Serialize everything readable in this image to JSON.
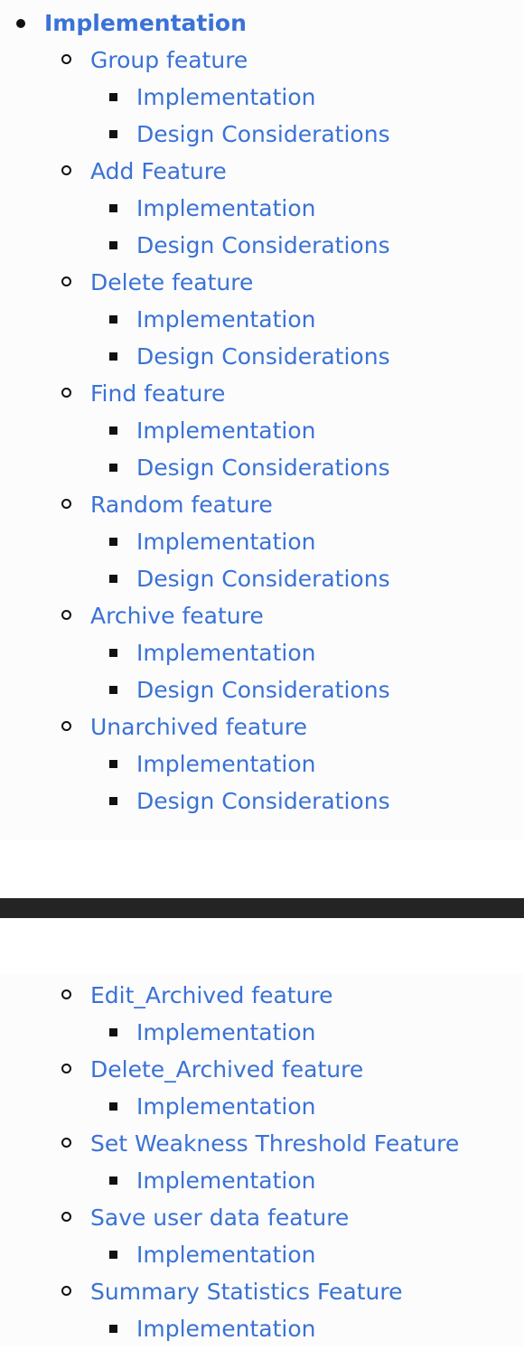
{
  "top": {
    "section_label": "Implementation",
    "features": [
      {
        "label": "Group feature",
        "children": [
          "Implementation",
          "Design Considerations"
        ]
      },
      {
        "label": "Add Feature",
        "children": [
          "Implementation",
          "Design Considerations"
        ]
      },
      {
        "label": "Delete feature",
        "children": [
          "Implementation",
          "Design Considerations"
        ]
      },
      {
        "label": "Find feature",
        "children": [
          "Implementation",
          "Design Considerations"
        ]
      },
      {
        "label": "Random feature",
        "children": [
          "Implementation",
          "Design Considerations"
        ]
      },
      {
        "label": "Archive feature",
        "children": [
          "Implementation",
          "Design Considerations"
        ]
      },
      {
        "label": "Unarchived feature",
        "children": [
          "Implementation",
          "Design Considerations"
        ]
      }
    ]
  },
  "bottom": {
    "features": [
      {
        "label": "Edit_Archived feature",
        "children": [
          "Implementation"
        ]
      },
      {
        "label": "Delete_Archived feature",
        "children": [
          "Implementation"
        ]
      },
      {
        "label": "Set Weakness Threshold Feature",
        "children": [
          "Implementation"
        ]
      },
      {
        "label": "Save user data feature",
        "children": [
          "Implementation"
        ]
      },
      {
        "label": "Summary Statistics Feature",
        "children": [
          "Implementation"
        ]
      }
    ]
  },
  "colors": {
    "link": "#3a72d6",
    "divider": "#242424",
    "panel_bg": "#fcfcfc"
  }
}
